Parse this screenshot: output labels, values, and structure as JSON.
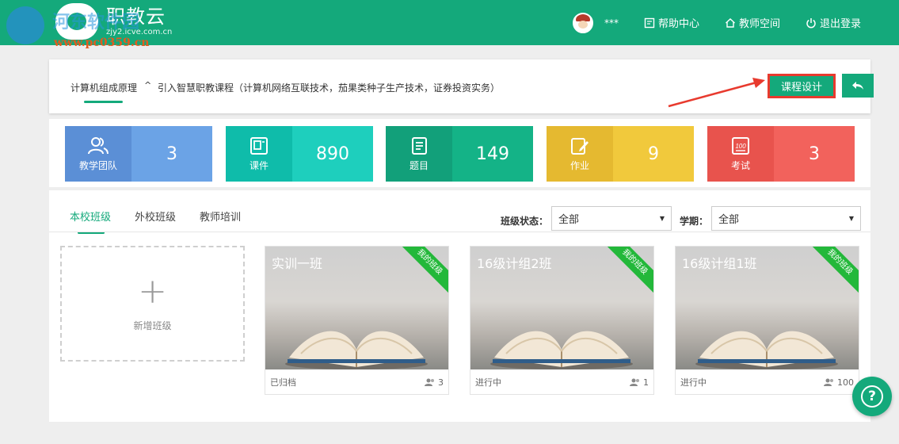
{
  "header": {
    "logo_title": "职教云",
    "logo_subtitle": "zjy2.icve.com.cn",
    "watermark_text": "河东软件园",
    "watermark_url": "www.pc0359.cn",
    "user_name": "***",
    "help_center": "帮助中心",
    "teacher_space": "教师空间",
    "logout": "退出登录"
  },
  "course": {
    "name": "计算机组成原理",
    "caret": "^",
    "import_text": "引入智慧职教课程（计算机网络互联技术，茄果类种子生产技术，证券投资实务）",
    "design_button": "课程设计",
    "back_icon": "reply-icon"
  },
  "stats": [
    {
      "label": "教学团队",
      "value": "3",
      "icon": "team-icon",
      "color_left": "#5b8fd6",
      "color_right": "#6ba3e6"
    },
    {
      "label": "课件",
      "value": "890",
      "icon": "courseware-icon",
      "color_left": "#0fbcaa",
      "color_right": "#1ecfbd"
    },
    {
      "label": "题目",
      "value": "149",
      "icon": "questions-icon",
      "color_left": "#12a07a",
      "color_right": "#14b387"
    },
    {
      "label": "作业",
      "value": "9",
      "icon": "homework-icon",
      "color_left": "#e5b930",
      "color_right": "#f1c93c"
    },
    {
      "label": "考试",
      "value": "3",
      "icon": "exam-icon",
      "color_left": "#e8534d",
      "color_right": "#f2625c"
    }
  ],
  "tabs": [
    "本校班级",
    "外校班级",
    "教师培训"
  ],
  "filters": {
    "status_label": "班级状态：",
    "status_value": "全部",
    "term_label": "学期：",
    "term_value": "全部"
  },
  "add_class": {
    "plus": "+",
    "label": "新增班级"
  },
  "classes": [
    {
      "title": "实训一班",
      "ribbon": "我的班级",
      "status": "已归档",
      "count": "3"
    },
    {
      "title": "16级计组2班",
      "ribbon": "我的班级",
      "status": "进行中",
      "count": "1"
    },
    {
      "title": "16级计组1班",
      "ribbon": "我的班级",
      "status": "进行中",
      "count": "100"
    }
  ],
  "help": {
    "symbol": "?"
  },
  "colors": {
    "brand": "#14a97b",
    "highlight": "#e83a2e"
  }
}
